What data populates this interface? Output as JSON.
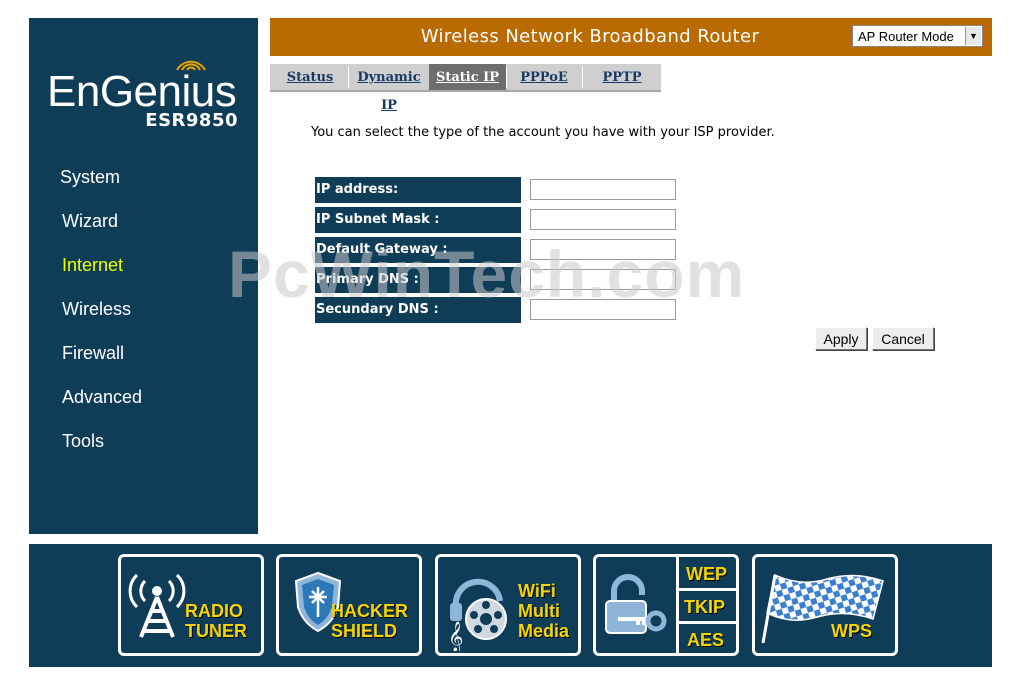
{
  "brand": {
    "logo": "EnGenius",
    "model": "ESR9850"
  },
  "sidebar": {
    "items": [
      {
        "label": "System"
      },
      {
        "label": "Wizard"
      },
      {
        "label": "Internet",
        "active": true
      },
      {
        "label": "Wireless"
      },
      {
        "label": "Firewall"
      },
      {
        "label": "Advanced"
      },
      {
        "label": "Tools"
      }
    ]
  },
  "header": {
    "title": "Wireless Network Broadband Router",
    "mode_select": {
      "value": "AP Router Mode"
    }
  },
  "tabs": [
    {
      "label": "Status"
    },
    {
      "label": "Dynamic IP"
    },
    {
      "label": "Static IP",
      "active": true
    },
    {
      "label": "PPPoE"
    },
    {
      "label": "PPTP"
    }
  ],
  "main": {
    "intro": "You can select the type of the account you have with your ISP provider.",
    "fields": [
      {
        "label": "IP address:",
        "value": ""
      },
      {
        "label": "IP Subnet Mask :",
        "value": ""
      },
      {
        "label": "Default Gateway :",
        "value": ""
      },
      {
        "label": "Primary DNS :",
        "value": ""
      },
      {
        "label": "Secundary DNS :",
        "value": ""
      }
    ],
    "apply_label": "Apply",
    "cancel_label": "Cancel"
  },
  "watermark": "PcWinTech.com",
  "banner": {
    "radio_tuner": [
      "RADIO",
      "TUNER"
    ],
    "hacker_shield": [
      "HACKER",
      "SHIELD"
    ],
    "wifi_multimedia": [
      "WiFi",
      "Multi",
      "Media"
    ],
    "encryption": [
      "WEP",
      "TKIP",
      "AES"
    ],
    "wps": "WPS"
  },
  "colors": {
    "navy": "#0f3d58",
    "header_orange": "#b96a00",
    "active_nav": "#f0ff00",
    "banner_text": "#f6d400"
  }
}
